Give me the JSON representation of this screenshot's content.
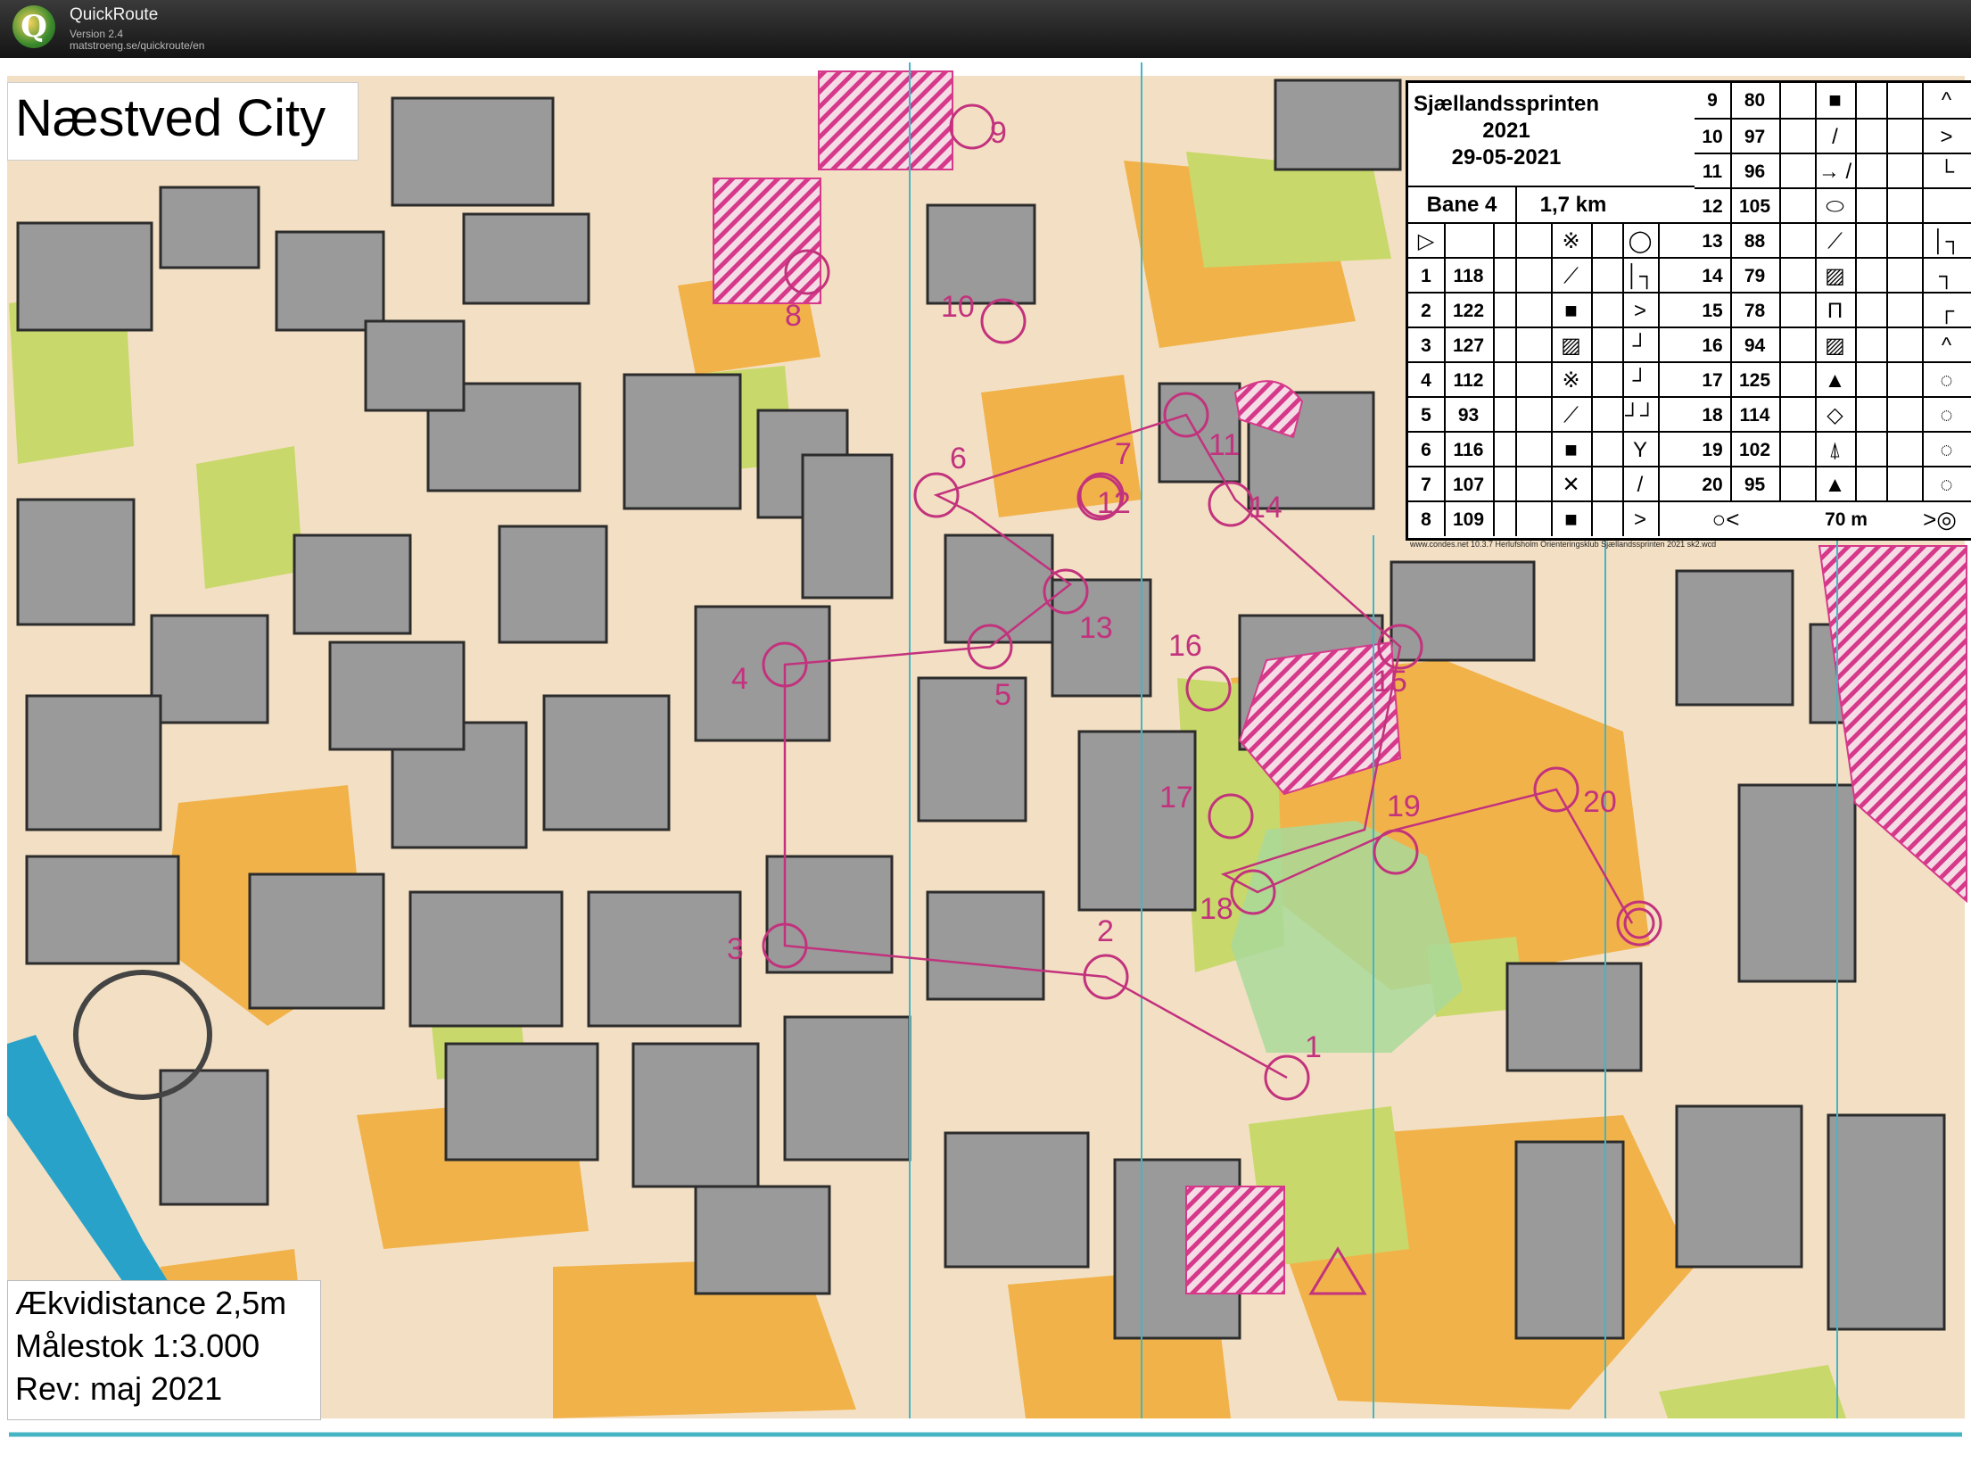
{
  "app": {
    "name": "QuickRoute",
    "version": "Version 2.4",
    "url": "matstroeng.se/quickroute/en",
    "logo_letter": "Q"
  },
  "map": {
    "title": "Næstved City",
    "info": [
      "Ækvidistance 2,5m",
      "Målestok 1:3.000",
      "Rev: maj 2021"
    ],
    "colors": {
      "building": "#9a9a9a",
      "paved": "#f3e0c4",
      "open_land": "#f2b24a",
      "vegetation": "#c9d86a",
      "forbidden": "#d6398a",
      "course": "#c2327d",
      "water": "#29a2c9",
      "magnetic_north": "#45b5c4"
    },
    "controls": [
      "1",
      "2",
      "3",
      "4",
      "5",
      "6",
      "7",
      "8",
      "9",
      "10",
      "11",
      "12",
      "13",
      "14",
      "15",
      "16",
      "17",
      "18",
      "19",
      "20"
    ]
  },
  "description_sheet": {
    "event": "Sjællandssprinten",
    "year": "2021",
    "date": "29-05-2021",
    "course": "Bane 4",
    "length": "1,7 km",
    "start_row": {
      "sym1": "▷",
      "sym2": "※",
      "sym3": "◯"
    },
    "rows_left": [
      {
        "n": "1",
        "code": "118",
        "sym": "steps",
        "dir": "│┐"
      },
      {
        "n": "2",
        "code": "122",
        "sym": "■",
        "dir": ">"
      },
      {
        "n": "3",
        "code": "127",
        "sym": "▨",
        "dir": "┘"
      },
      {
        "n": "4",
        "code": "112",
        "sym": "※",
        "dir": "┘"
      },
      {
        "n": "5",
        "code": "93",
        "sym": "steps",
        "dir": "┘┘"
      },
      {
        "n": "6",
        "code": "116",
        "sym": "■",
        "dir": "Y"
      },
      {
        "n": "7",
        "code": "107",
        "sym": "✕",
        "dir": "/"
      },
      {
        "n": "8",
        "code": "109",
        "sym": "■",
        "dir": ">"
      }
    ],
    "rows_right": [
      {
        "n": "9",
        "code": "80",
        "sym": "■",
        "dir": "^"
      },
      {
        "n": "10",
        "code": "97",
        "sym": "/",
        "dir": ">"
      },
      {
        "n": "11",
        "code": "96",
        "sym": "→ /",
        "dir": "└"
      },
      {
        "n": "12",
        "code": "105",
        "sym": "⬭",
        "dir": ""
      },
      {
        "n": "13",
        "code": "88",
        "sym": "steps",
        "dir": "│┐"
      },
      {
        "n": "14",
        "code": "79",
        "sym": "▨",
        "dir": "┐"
      },
      {
        "n": "15",
        "code": "78",
        "sym": "Π",
        "dir": "┌"
      },
      {
        "n": "16",
        "code": "94",
        "sym": "▨",
        "dir": "^"
      },
      {
        "n": "17",
        "code": "125",
        "sym": "▲",
        "dir": "◌"
      },
      {
        "n": "18",
        "code": "114",
        "sym": "◇",
        "dir": "◌"
      },
      {
        "n": "19",
        "code": "102",
        "sym": "⍋",
        "dir": "◌"
      },
      {
        "n": "20",
        "code": "95",
        "sym": "▲",
        "dir": "◌"
      }
    ],
    "finish": {
      "left": "○<",
      "distance": "70 m",
      "right": ">◎"
    },
    "footnote": "www.condes.net 10.3.7 Herlufsholm Orienteringsklub Sjællandssprinten 2021 sk2.wcd"
  }
}
